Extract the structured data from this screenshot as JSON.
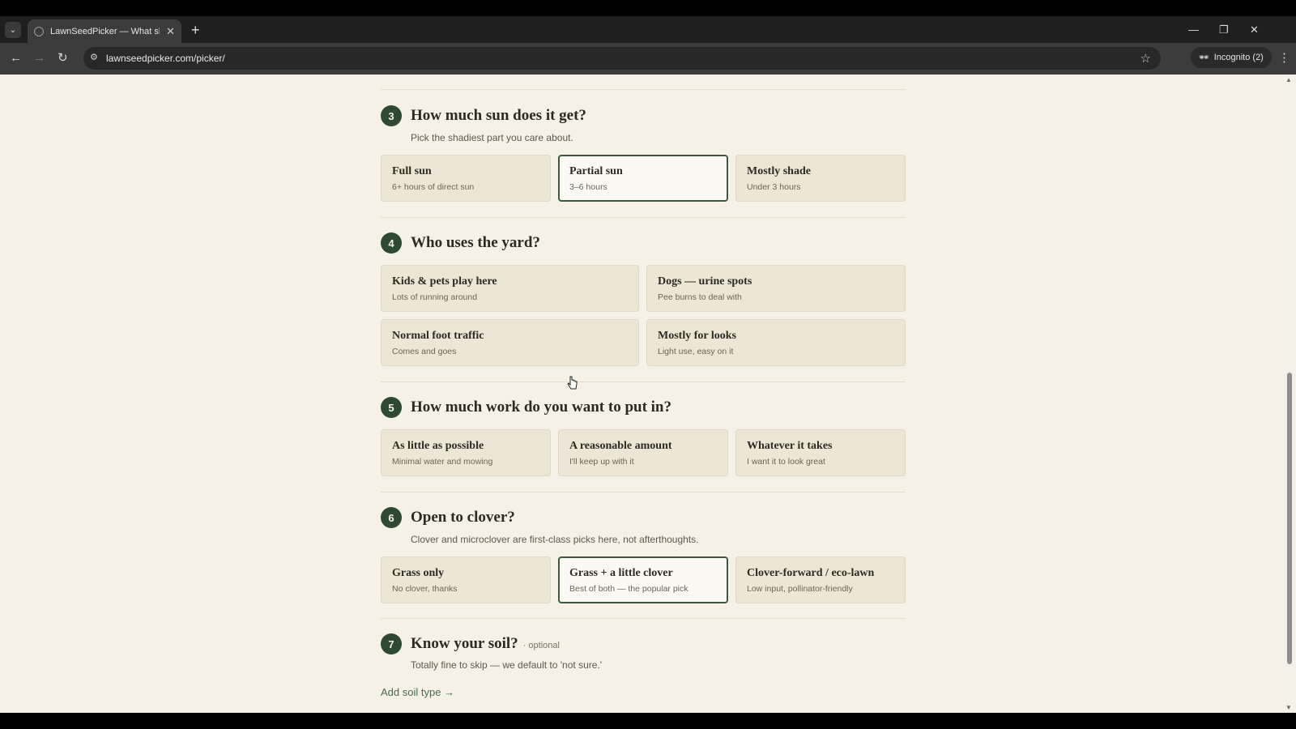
{
  "browser": {
    "tab_title": "LawnSeedPicker — What should",
    "url": "lawnseedpicker.com/picker/",
    "incognito_label": "Incognito (2)",
    "icons": {
      "tab_list": "chevron-down",
      "new_tab": "plus",
      "back": "arrow-left",
      "forward": "arrow-right",
      "reload": "reload",
      "bookmark": "star",
      "menu": "kebab"
    },
    "glyphs": {
      "tab_list": "⌄",
      "tab_close": "✕",
      "new_tab": "+",
      "minimize": "—",
      "restore": "❐",
      "close": "✕",
      "back": "←",
      "forward": "→",
      "reload": "↻",
      "site_info": "⚙",
      "star": "☆",
      "incognito": "🕶",
      "kebab": "⋮"
    }
  },
  "questions": [
    {
      "number": "3",
      "title": "How much sun does it get?",
      "subtitle": "Pick the shadiest part you care about.",
      "options": [
        {
          "title": "Full sun",
          "subtitle": "6+ hours of direct sun",
          "selected": false
        },
        {
          "title": "Partial sun",
          "subtitle": "3–6 hours",
          "selected": true
        },
        {
          "title": "Mostly shade",
          "subtitle": "Under 3 hours",
          "selected": false
        }
      ]
    },
    {
      "number": "4",
      "title": "Who uses the yard?",
      "options": [
        {
          "title": "Kids & pets play here",
          "subtitle": "Lots of running around",
          "selected": false
        },
        {
          "title": "Dogs — urine spots",
          "subtitle": "Pee burns to deal with",
          "selected": false
        },
        {
          "title": "Normal foot traffic",
          "subtitle": "Comes and goes",
          "selected": false
        },
        {
          "title": "Mostly for looks",
          "subtitle": "Light use, easy on it",
          "selected": false
        }
      ]
    },
    {
      "number": "5",
      "title": "How much work do you want to put in?",
      "options": [
        {
          "title": "As little as possible",
          "subtitle": "Minimal water and mowing",
          "selected": false
        },
        {
          "title": "A reasonable amount",
          "subtitle": "I'll keep up with it",
          "selected": false
        },
        {
          "title": "Whatever it takes",
          "subtitle": "I want it to look great",
          "selected": false
        }
      ]
    },
    {
      "number": "6",
      "title": "Open to clover?",
      "subtitle": "Clover and microclover are first-class picks here, not afterthoughts.",
      "options": [
        {
          "title": "Grass only",
          "subtitle": "No clover, thanks",
          "selected": false
        },
        {
          "title": "Grass + a little clover",
          "subtitle": "Best of both — the popular pick",
          "selected": true
        },
        {
          "title": "Clover-forward / eco-lawn",
          "subtitle": "Low input, pollinator-friendly",
          "selected": false
        }
      ]
    },
    {
      "number": "7",
      "title": "Know your soil?",
      "optional_label": "· optional",
      "subtitle": "Totally fine to skip — we default to 'not sure.'",
      "link": "Add soil type →"
    }
  ],
  "colors": {
    "page_bg": "#f5f1e6",
    "card_bg": "#ede6d5",
    "accent_green": "#2f4a33"
  }
}
